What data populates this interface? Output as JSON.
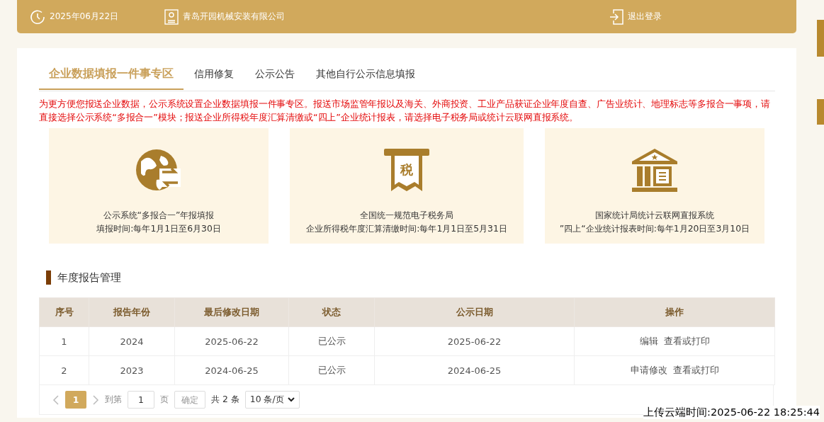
{
  "header": {
    "date": "2025年06月22日",
    "company": "青岛开园机械安装有限公司",
    "logout": "退出登录"
  },
  "tabs": [
    {
      "label": "企业数据填报一件事专区",
      "selected": true
    },
    {
      "label": "信用修复",
      "selected": false
    },
    {
      "label": "公示公告",
      "selected": false
    },
    {
      "label": "其他自行公示信息填报",
      "selected": false
    }
  ],
  "notice": "为更方便您报送企业数据，公示系统设置企业数据填报一件事专区。报送市场监管年报以及海关、外商投资、工业产品获证企业年度自查、广告业统计、地理标志等多报合一事项，请直接选择公示系统“多报合一”模块；报送企业所得税年度汇算清缴或“四上”企业统计报表，请选择电子税务局或统计云联网直报系统。",
  "services": [
    {
      "kind": "globe",
      "title": "公示系统“多报合一”年报填报",
      "subtitle": "填报时间:每年1月1日至6月30日"
    },
    {
      "kind": "tax",
      "icon_text": "税",
      "title": "全国统一规范电子税务局",
      "subtitle": "企业所得税年度汇算清缴时间:每年1月1日至5月31日"
    },
    {
      "kind": "bank",
      "title": "国家统计局统计云联网直报系统",
      "subtitle": "”四上“企业统计报表时间:每年1月20日至3月10日"
    }
  ],
  "section_title": "年度报告管理",
  "table": {
    "columns": [
      "序号",
      "报告年份",
      "最后修改日期",
      "状态",
      "公示日期",
      "操作"
    ],
    "rows": [
      {
        "cells": [
          "1",
          "2024",
          "2025-06-22",
          "已公示",
          "2025-06-22"
        ],
        "actions": [
          "编辑",
          "查看或打印"
        ]
      },
      {
        "cells": [
          "2",
          "2023",
          "2024-06-25",
          "已公示",
          "2024-06-25"
        ],
        "actions": [
          "申请修改",
          "查看或打印"
        ]
      }
    ]
  },
  "pagination": {
    "pages": [
      {
        "label": "1",
        "selected": true
      }
    ],
    "goto_label": "到第",
    "goto_value": "1",
    "page_label": "页",
    "confirm": "确定",
    "total": "共 2 条",
    "page_size": "10 条/页"
  },
  "upload_time": "上传云端时间:2025-06-22 18:25:44"
}
